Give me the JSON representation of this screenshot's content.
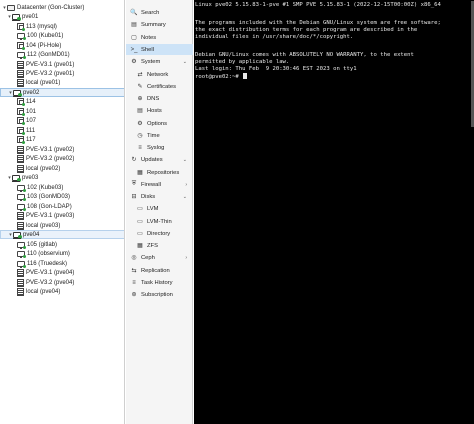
{
  "tree": {
    "rows": [
      {
        "label": "Datacenter (Gon-Cluster)",
        "kind": "dc",
        "twisty": "▾"
      },
      {
        "label": "pve01",
        "kind": "node",
        "twisty": "▾"
      },
      {
        "label": "113 (mysql)",
        "kind": "ct"
      },
      {
        "label": "100 (Kube01)",
        "kind": "vm"
      },
      {
        "label": "104 (Pi-Hole)",
        "kind": "ct"
      },
      {
        "label": "112 (GonMD01)",
        "kind": "vm"
      },
      {
        "label": "PVE-V3.1 (pve01)",
        "kind": "storage"
      },
      {
        "label": "PVE-V3.2 (pve01)",
        "kind": "storage"
      },
      {
        "label": "local (pve01)",
        "kind": "storage"
      },
      {
        "label": "pve02",
        "kind": "node",
        "twisty": "▾",
        "selected": true
      },
      {
        "label": "114",
        "kind": "ct"
      },
      {
        "label": "101",
        "kind": "ct"
      },
      {
        "label": "107",
        "kind": "ct"
      },
      {
        "label": "111",
        "kind": "ct"
      },
      {
        "label": "117",
        "kind": "ct"
      },
      {
        "label": "PVE-V3.1 (pve02)",
        "kind": "storage"
      },
      {
        "label": "PVE-V3.2 (pve02)",
        "kind": "storage"
      },
      {
        "label": "local (pve02)",
        "kind": "storage"
      },
      {
        "label": "pve03",
        "kind": "node",
        "twisty": "▾"
      },
      {
        "label": "102 (Kube03)",
        "kind": "vm"
      },
      {
        "label": "103 (GonMD03)",
        "kind": "vm"
      },
      {
        "label": "108 (Gon-LDAP)",
        "kind": "vm"
      },
      {
        "label": "PVE-V3.1 (pve03)",
        "kind": "storage"
      },
      {
        "label": "local (pve03)",
        "kind": "storage"
      },
      {
        "label": "pve04",
        "kind": "node",
        "twisty": "▾",
        "highlight": true
      },
      {
        "label": "105 (gitlab)",
        "kind": "vm"
      },
      {
        "label": "110 (observium)",
        "kind": "vm"
      },
      {
        "label": "116 (Truedesk)",
        "kind": "vm"
      },
      {
        "label": "PVE-V3.1 (pve04)",
        "kind": "storage"
      },
      {
        "label": "PVE-V3.2 (pve04)",
        "kind": "storage"
      },
      {
        "label": "local (pve04)",
        "kind": "storage"
      }
    ]
  },
  "menu": {
    "items": [
      {
        "label": "Search",
        "icon": "🔍",
        "iconName": "search-icon"
      },
      {
        "label": "Summary",
        "icon": "▤",
        "iconName": "summary-icon"
      },
      {
        "label": "Notes",
        "icon": "▢",
        "iconName": "notes-icon"
      },
      {
        "label": "Shell",
        "icon": ">_",
        "iconName": "shell-icon",
        "active": true
      },
      {
        "label": "System",
        "icon": "⚙",
        "iconName": "gear-icon",
        "chevron": "⌄"
      },
      {
        "label": "Network",
        "icon": "⇄",
        "iconName": "network-icon",
        "sub": true
      },
      {
        "label": "Certificates",
        "icon": "✎",
        "iconName": "certificate-icon",
        "sub": true
      },
      {
        "label": "DNS",
        "icon": "⊕",
        "iconName": "globe-icon",
        "sub": true
      },
      {
        "label": "Hosts",
        "icon": "▤",
        "iconName": "hosts-icon",
        "sub": true
      },
      {
        "label": "Options",
        "icon": "⚙",
        "iconName": "options-gear-icon",
        "sub": true
      },
      {
        "label": "Time",
        "icon": "◷",
        "iconName": "clock-icon",
        "sub": true
      },
      {
        "label": "Syslog",
        "icon": "≡",
        "iconName": "list-icon",
        "sub": true
      },
      {
        "label": "Updates",
        "icon": "↻",
        "iconName": "refresh-icon",
        "chevron": "⌄"
      },
      {
        "label": "Repositories",
        "icon": "▦",
        "iconName": "repository-icon",
        "sub": true
      },
      {
        "label": "Firewall",
        "icon": "⛨",
        "iconName": "shield-icon",
        "chevron": "›"
      },
      {
        "label": "Disks",
        "icon": "⊟",
        "iconName": "disk-icon",
        "chevron": "⌄"
      },
      {
        "label": "LVM",
        "icon": "▭",
        "iconName": "lvm-icon",
        "sub": true
      },
      {
        "label": "LVM-Thin",
        "icon": "▭",
        "iconName": "lvm-thin-icon",
        "sub": true
      },
      {
        "label": "Directory",
        "icon": "▭",
        "iconName": "folder-icon",
        "sub": true
      },
      {
        "label": "ZFS",
        "icon": "▦",
        "iconName": "zfs-icon",
        "sub": true
      },
      {
        "label": "Ceph",
        "icon": "◎",
        "iconName": "ceph-icon",
        "chevron": "›"
      },
      {
        "label": "Replication",
        "icon": "⇆",
        "iconName": "replication-icon"
      },
      {
        "label": "Task History",
        "icon": "≡",
        "iconName": "task-history-icon"
      },
      {
        "label": "Subscription",
        "icon": "⊛",
        "iconName": "subscription-icon"
      }
    ]
  },
  "terminal": {
    "lines": [
      "Linux pve02 5.15.83-1-pve #1 SMP PVE 5.15.83-1 (2022-12-15T00:00Z) x86_64",
      "",
      "The programs included with the Debian GNU/Linux system are free software;",
      "the exact distribution terms for each program are described in the",
      "individual files in /usr/share/doc/*/copyright.",
      "",
      "Debian GNU/Linux comes with ABSOLUTELY NO WARRANTY, to the extent",
      "permitted by applicable law.",
      "Last login: Thu Feb  9 20:30:46 EST 2023 on tty1",
      "root@pve02:~# "
    ]
  }
}
